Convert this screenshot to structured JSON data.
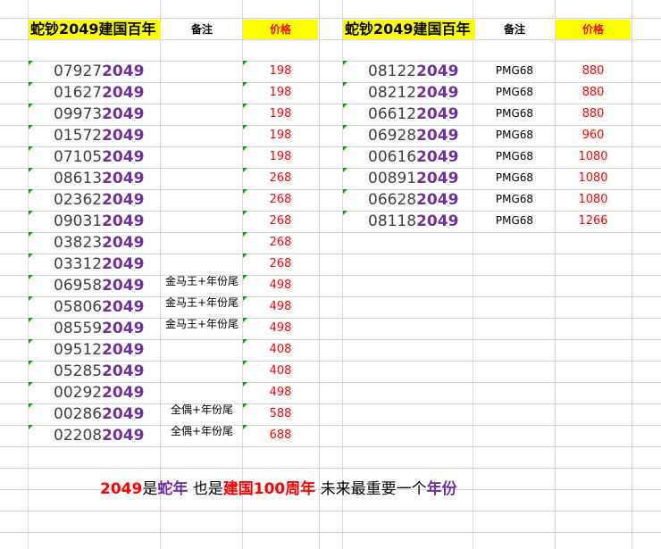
{
  "left_table": {
    "title": "蛇钞2049建国百年",
    "note_header": "备注",
    "price_header": "价格",
    "rows": [
      {
        "prefix": "07927",
        "suffix": "2049",
        "note": "",
        "price": "198"
      },
      {
        "prefix": "01627",
        "suffix": "2049",
        "note": "",
        "price": "198"
      },
      {
        "prefix": "09973",
        "suffix": "2049",
        "note": "",
        "price": "198"
      },
      {
        "prefix": "01572",
        "suffix": "2049",
        "note": "",
        "price": "198"
      },
      {
        "prefix": "07105",
        "suffix": "2049",
        "note": "",
        "price": "198"
      },
      {
        "prefix": "08613",
        "suffix": "2049",
        "note": "",
        "price": "268"
      },
      {
        "prefix": "02362",
        "suffix": "2049",
        "note": "",
        "price": "268"
      },
      {
        "prefix": "09031",
        "suffix": "2049",
        "note": "",
        "price": "268"
      },
      {
        "prefix": "03823",
        "suffix": "2049",
        "note": "",
        "price": "268"
      },
      {
        "prefix": "03312",
        "suffix": "2049",
        "note": "",
        "price": "268"
      },
      {
        "prefix": "06958",
        "suffix": "2049",
        "note": "金马王+年份尾",
        "price": "498"
      },
      {
        "prefix": "05806",
        "suffix": "2049",
        "note": "金马王+年份尾",
        "price": "498"
      },
      {
        "prefix": "08559",
        "suffix": "2049",
        "note": "金马王+年份尾",
        "price": "498"
      },
      {
        "prefix": "09512",
        "suffix": "2049",
        "note": "",
        "price": "408"
      },
      {
        "prefix": "05285",
        "suffix": "2049",
        "note": "",
        "price": "408"
      },
      {
        "prefix": "00292",
        "suffix": "2049",
        "note": "",
        "price": "498"
      },
      {
        "prefix": "00286",
        "suffix": "2049",
        "note": "全偶+年份尾",
        "price": "588"
      },
      {
        "prefix": "02208",
        "suffix": "2049",
        "note": "全偶+年份尾",
        "price": "688"
      }
    ]
  },
  "right_table": {
    "title": "蛇钞2049建国百年",
    "note_header": "备注",
    "price_header": "价格",
    "rows": [
      {
        "prefix": "08122",
        "suffix": "2049",
        "note": "PMG68",
        "price": "880"
      },
      {
        "prefix": "08212",
        "suffix": "2049",
        "note": "PMG68",
        "price": "880"
      },
      {
        "prefix": "06612",
        "suffix": "2049",
        "note": "PMG68",
        "price": "880"
      },
      {
        "prefix": "06928",
        "suffix": "2049",
        "note": "PMG68",
        "price": "960"
      },
      {
        "prefix": "00616",
        "suffix": "2049",
        "note": "PMG68",
        "price": "1080"
      },
      {
        "prefix": "00891",
        "suffix": "2049",
        "note": "PMG68",
        "price": "1080"
      },
      {
        "prefix": "06628",
        "suffix": "2049",
        "note": "PMG68",
        "price": "1080"
      },
      {
        "prefix": "08118",
        "suffix": "2049",
        "note": "PMG68",
        "price": "1266"
      }
    ]
  },
  "slogan": {
    "part1": "2049",
    "part2": "是",
    "part3": "蛇年",
    "part4": " 也是",
    "part5": "建国100周年",
    "part6": " 未来最重要一个",
    "part7": "年份"
  },
  "colors": {
    "highlight": "#ffff00",
    "price": "#ff0000",
    "year_suffix": "#7030a0",
    "grid": "#d9d9d9",
    "comment_marker": "#00a000"
  }
}
